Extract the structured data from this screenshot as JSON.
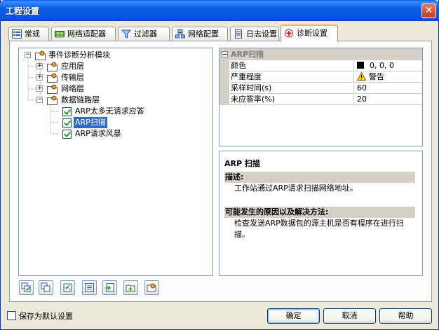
{
  "window": {
    "title": "工程设置",
    "close_glyph": "✕"
  },
  "tabs": [
    {
      "label": "常规",
      "icon": "list-icon"
    },
    {
      "label": "网络适配器",
      "icon": "network-card-icon"
    },
    {
      "label": "过滤器",
      "icon": "funnel-icon"
    },
    {
      "label": "网络配置",
      "icon": "network-config-icon"
    },
    {
      "label": "日志设置",
      "icon": "log-icon"
    },
    {
      "label": "诊断设置",
      "icon": "diagnostic-icon",
      "active": true
    }
  ],
  "tree": {
    "root": "事件诊断分析模块",
    "layers": [
      "应用层",
      "传输层",
      "网络层",
      "数据链路层"
    ],
    "datalink_items": [
      "ARP太多无请求应答",
      "ARP扫描",
      "ARP请求风暴"
    ],
    "selected": "ARP扫描",
    "expand_plus": "+",
    "expand_minus": "−"
  },
  "properties": {
    "category": "ARP扫描",
    "rows": [
      {
        "name": "颜色",
        "value": "0, 0, 0"
      },
      {
        "name": "严重程度",
        "value": "警告"
      },
      {
        "name": "采样时间(s)",
        "value": "60"
      },
      {
        "name": "未应答率(%)",
        "value": "20"
      }
    ],
    "color_swatch": "#000000"
  },
  "description": {
    "title": "ARP 扫描",
    "desc_head": "描述:",
    "desc_text": "工作站通过ARP请求扫描网络地址。",
    "cause_head": "可能发生的原因以及解决方法:",
    "cause_text": "检查发送ARP数据包的源主机是否有程序在进行扫描。"
  },
  "footer": {
    "save_default": "保存为默认设置",
    "ok": "确定",
    "cancel": "取消",
    "help": "帮助"
  },
  "colors": {
    "title_bar": "#0a5fe6",
    "selection": "#316ac5",
    "window_bg": "#ece9d8"
  }
}
